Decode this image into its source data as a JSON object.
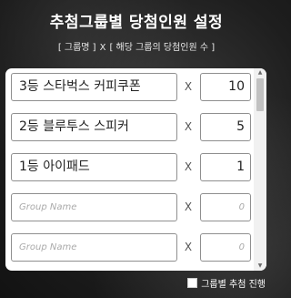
{
  "header": {
    "title": "추첨그룹별 당첨인원 설정",
    "subtitle_left": "[ 그룹명 ]",
    "subtitle_sep": "X",
    "subtitle_right": "[ 해당 그룹의 당첨인원 수 ]"
  },
  "rows": [
    {
      "name": "3등 스타벅스 커피쿠폰",
      "times": "X",
      "count": "10"
    },
    {
      "name": "2등 블루투스 스피커",
      "times": "X",
      "count": "5"
    },
    {
      "name": "1등 아이패드",
      "times": "X",
      "count": "1"
    },
    {
      "name": "",
      "name_placeholder": "Group Name",
      "times": "X",
      "count": "",
      "count_placeholder": "0"
    },
    {
      "name": "",
      "name_placeholder": "Group Name",
      "times": "X",
      "count": "",
      "count_placeholder": "0"
    }
  ],
  "scrollbar": {
    "up_icon": "arrow-up-icon",
    "down_icon": "arrow-down-icon"
  },
  "footer": {
    "checkbox_checked": false,
    "checkbox_label": "그룹별 추첨 진행"
  }
}
